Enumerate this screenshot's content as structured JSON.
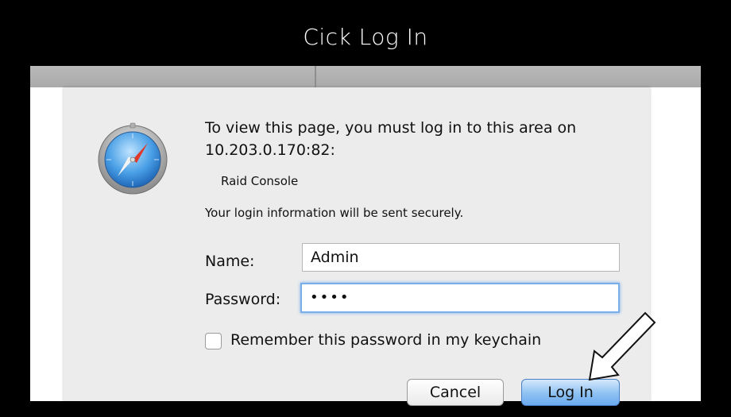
{
  "caption": "Cick Log In",
  "dialog": {
    "message": "To view this page, you must log in to this area on 10.203.0.170:82:",
    "realm": "Raid Console",
    "secure_note": "Your login information will be sent securely.",
    "name_label": "Name:",
    "name_value": "Admin",
    "password_label": "Password:",
    "password_value": "••••",
    "remember_label": "Remember this password in my keychain",
    "remember_checked": false,
    "cancel_label": "Cancel",
    "login_label": "Log In"
  },
  "icons": {
    "app_icon": "safari-compass-icon",
    "pointer": "arrow-pointer-icon"
  },
  "colors": {
    "focus_ring": "#7aaee8",
    "default_button": "#6aaaf0",
    "sheet_background": "#ececec"
  }
}
